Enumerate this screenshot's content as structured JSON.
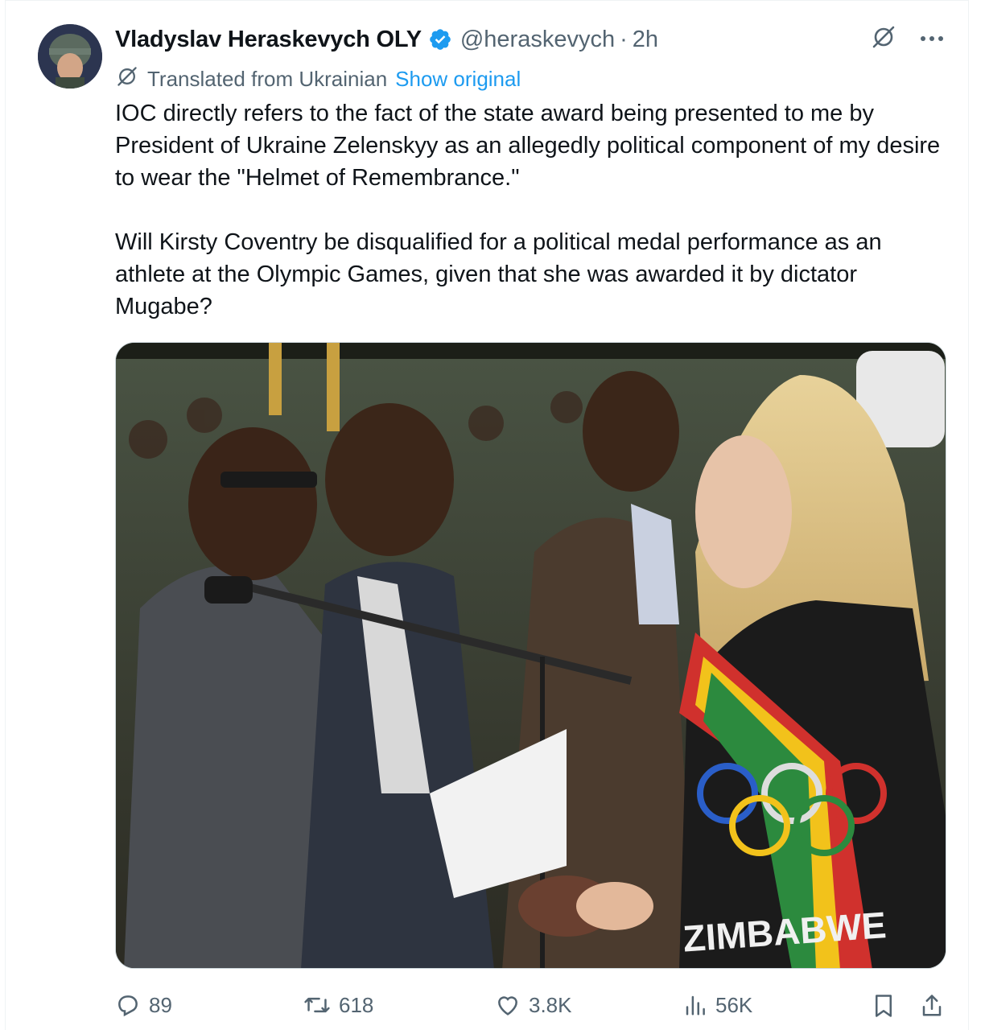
{
  "tweet": {
    "author_name": "Vladyslav Heraskevych OLY",
    "handle": "@heraskevych",
    "separator": "·",
    "time": "2h",
    "translation_note": "Translated from Ukrainian",
    "show_original_label": "Show original",
    "paragraphs": [
      "IOC directly refers to the fact of the state award being presented to me by President of Ukraine Zelenskyy as an allegedly political component of my desire to wear the \"Helmet of Remembrance.\"",
      "Will Kirsty Coventry be disqualified for a political medal performance as an athlete at the Olympic Games, given that she was awarded it by dictator Mugabe?"
    ],
    "media_shirt_text": "ZIMBABWE"
  },
  "actions": {
    "replies": "89",
    "reposts": "618",
    "likes": "3.8K",
    "views": "56K"
  },
  "icons": {
    "verified": "verified-badge-icon",
    "grok": "grok-icon",
    "more": "more-options-icon",
    "translate": "translate-icon",
    "reply": "reply-icon",
    "repost": "repost-icon",
    "like": "like-icon",
    "views": "views-icon",
    "bookmark": "bookmark-icon",
    "share": "share-icon"
  },
  "colors": {
    "accent": "#1d9bf0",
    "secondary_text": "#536471",
    "primary_text": "#0f1419"
  }
}
